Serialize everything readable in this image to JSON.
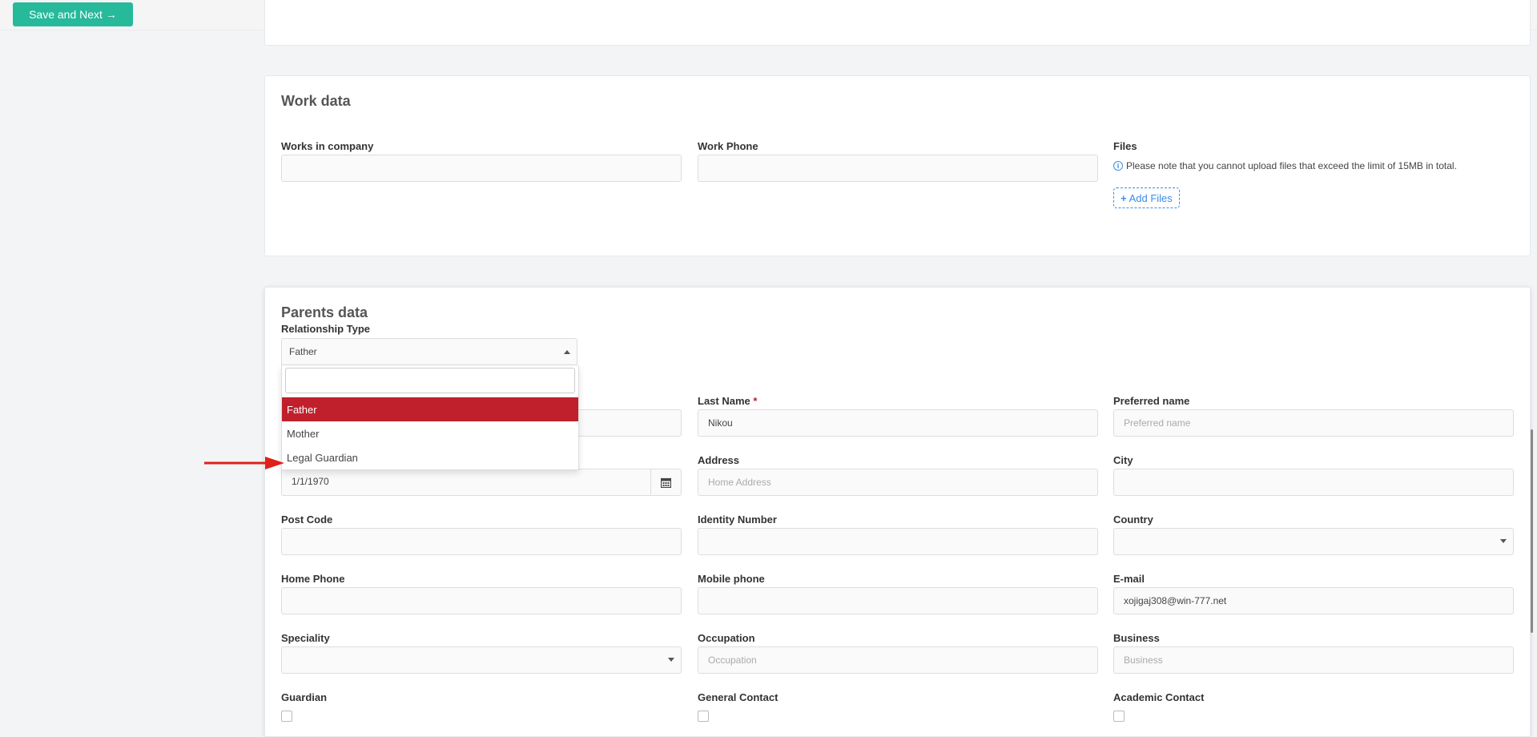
{
  "toolbar": {
    "save_next_label": "Save and Next",
    "save_next_arrow": "→"
  },
  "work": {
    "title": "Work data",
    "works_in_company_label": "Works in company",
    "work_phone_label": "Work Phone",
    "files_label": "Files",
    "files_note": "Please note that you cannot upload files that exceed the limit of 15MB in total.",
    "add_files_label": "Add Files"
  },
  "parents": {
    "title": "Parents data",
    "relationship_type_label": "Relationship Type",
    "relationship_type_value": "Father",
    "relationship_options": [
      "Father",
      "Mother",
      "Legal Guardian"
    ],
    "last_name_label": "Last Name",
    "required_mark": "*",
    "last_name_value": "Nikou",
    "preferred_name_label": "Preferred name",
    "preferred_name_placeholder": "Preferred name",
    "birth_date_value": "1/1/1970",
    "address_label": "Address",
    "address_placeholder": "Home Address",
    "city_label": "City",
    "post_code_label": "Post Code",
    "identity_number_label": "Identity Number",
    "country_label": "Country",
    "home_phone_label": "Home Phone",
    "mobile_phone_label": "Mobile phone",
    "email_label": "E-mail",
    "email_value": "xojigaj308@win-777.net",
    "speciality_label": "Speciality",
    "occupation_label": "Occupation",
    "occupation_placeholder": "Occupation",
    "business_label": "Business",
    "business_placeholder": "Business",
    "guardian_label": "Guardian",
    "general_contact_label": "General Contact",
    "academic_contact_label": "Academic Contact"
  },
  "colors": {
    "accent": "#26b99a",
    "selected": "#c0202c",
    "link": "#3a8ee6",
    "annotation_arrow": "#e0201a"
  },
  "icons": [
    "arrow-right-icon",
    "info-icon",
    "plus-icon",
    "caret-up-icon",
    "caret-down-icon",
    "calendar-icon"
  ]
}
